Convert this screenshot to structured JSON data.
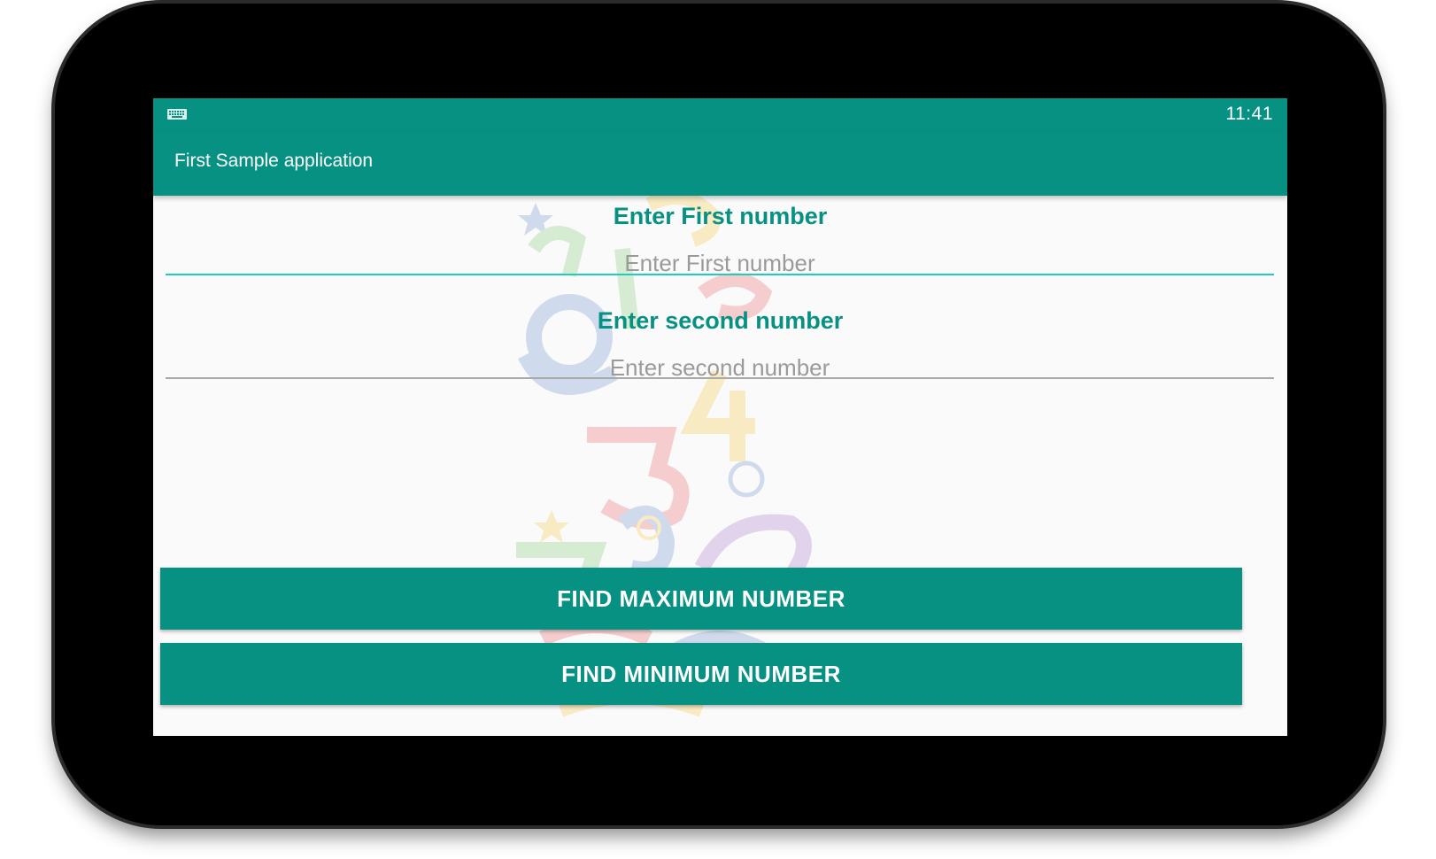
{
  "colors": {
    "accent": "#079183",
    "focus_line": "#1ccdc0",
    "idle_line": "#a8a8a8"
  },
  "status_bar": {
    "time": "11:41",
    "icon": "keyboard-icon"
  },
  "app_bar": {
    "title": "First Sample application"
  },
  "form": {
    "first": {
      "label": "Enter First number",
      "placeholder": "Enter First number",
      "value": ""
    },
    "second": {
      "label": "Enter second number",
      "placeholder": "Enter second number",
      "value": ""
    }
  },
  "buttons": {
    "max_label": "FIND MAXIMUM NUMBER",
    "min_label": "FIND MINIMUM NUMBER"
  }
}
